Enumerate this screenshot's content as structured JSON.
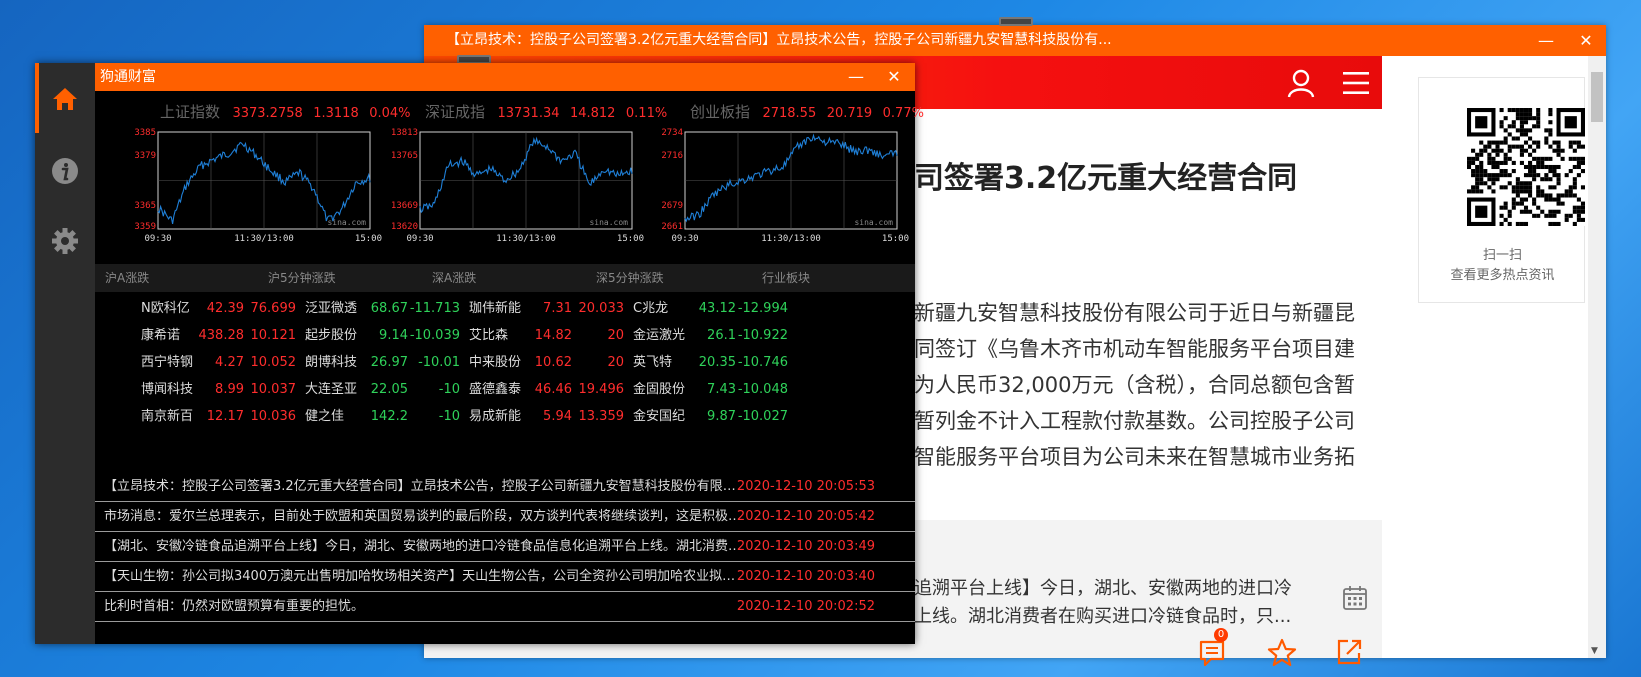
{
  "news_window": {
    "title": "【立昂技术：控股子公司签署3.2亿元重大经营合同】立昂技术公告，控股子公司新疆九安智慧科技股份有...",
    "minimize": "—",
    "close": "✕",
    "article_title": "司签署3.2亿元重大经营合同",
    "article_lines": [
      "新疆九安智慧科技股份有限公司于近日与新疆昆",
      "同签订《乌鲁木齐市机动车智能服务平台项目建",
      "为人民币32,000万元（含税），合同总额包含暂",
      "暂列金不计入工程款付款基数。公司控股子公司",
      "智能服务平台项目为公司未来在智慧城市业务拓"
    ],
    "related_lines": [
      "追溯平台上线】今日，湖北、安徽两地的进口冷",
      "上线。湖北消费者在购买进口冷链食品时，只..."
    ],
    "comment_count": "0",
    "qr_caption_line1": "扫一扫",
    "qr_caption_line2": "查看更多热点资讯",
    "scroll_down": "▼"
  },
  "stock_window": {
    "title": "狗通财富",
    "minimize": "—",
    "close": "✕",
    "sidebar": [
      {
        "name": "home",
        "icon": "home-icon",
        "active": true
      },
      {
        "name": "info",
        "icon": "info-icon",
        "active": false
      },
      {
        "name": "settings",
        "icon": "gear-icon",
        "active": false
      }
    ],
    "indices": [
      {
        "name": "上证指数",
        "value": "3373.2758",
        "change": "1.3118",
        "pct": "0.04%"
      },
      {
        "name": "深证成指",
        "value": "13731.34",
        "change": "14.812",
        "pct": "0.11%"
      },
      {
        "name": "创业板指",
        "value": "2718.55",
        "change": "20.719",
        "pct": "0.77%"
      }
    ],
    "charts": [
      {
        "y_labels": [
          "3385",
          "3379",
          "3365",
          "3359"
        ],
        "x_labels": [
          "09:30",
          "11:30/13:00",
          "15:00"
        ],
        "watermark": "sina.com"
      },
      {
        "y_labels": [
          "13813",
          "13765",
          "13669",
          "13620"
        ],
        "x_labels": [
          "09:30",
          "11:30/13:00",
          "15:00"
        ],
        "watermark": "sina.com"
      },
      {
        "y_labels": [
          "2734",
          "2716",
          "2679",
          "2661"
        ],
        "x_labels": [
          "09:30",
          "11:30/13:00",
          "15:00"
        ],
        "watermark": "sina.com"
      }
    ],
    "sections": [
      "沪A涨跌",
      "沪5分钟涨跌",
      "深A涨跌",
      "深5分钟涨跌",
      "行业板块"
    ],
    "columns": [
      {
        "direction": "up",
        "rows": [
          {
            "name": "N欧科亿",
            "price": "42.39",
            "change": "76.699"
          },
          {
            "name": "康希诺",
            "price": "438.28",
            "change": "10.121"
          },
          {
            "name": "西宁特钢",
            "price": "4.27",
            "change": "10.052"
          },
          {
            "name": "博闻科技",
            "price": "8.99",
            "change": "10.037"
          },
          {
            "name": "南京新百",
            "price": "12.17",
            "change": "10.036"
          }
        ]
      },
      {
        "direction": "down",
        "rows": [
          {
            "name": "泛亚微透",
            "price": "68.67",
            "change": "-11.713"
          },
          {
            "name": "起步股份",
            "price": "9.14",
            "change": "-10.039"
          },
          {
            "name": "朗博科技",
            "price": "26.97",
            "change": "-10.01"
          },
          {
            "name": "大连圣亚",
            "price": "22.05",
            "change": "-10"
          },
          {
            "name": "健之佳",
            "price": "142.2",
            "change": "-10"
          }
        ]
      },
      {
        "direction": "up",
        "rows": [
          {
            "name": "珈伟新能",
            "price": "7.31",
            "change": "20.033"
          },
          {
            "name": "艾比森",
            "price": "14.82",
            "change": "20"
          },
          {
            "name": "中来股份",
            "price": "10.62",
            "change": "20"
          },
          {
            "name": "盛德鑫泰",
            "price": "46.46",
            "change": "19.496"
          },
          {
            "name": "易成新能",
            "price": "5.94",
            "change": "13.359"
          }
        ]
      },
      {
        "direction": "down",
        "rows": [
          {
            "name": "C兆龙",
            "price": "43.12",
            "change": "-12.994"
          },
          {
            "name": "金运激光",
            "price": "26.1",
            "change": "-10.922"
          },
          {
            "name": "英飞特",
            "price": "20.35",
            "change": "-10.746"
          },
          {
            "name": "金固股份",
            "price": "7.43",
            "change": "-10.048"
          },
          {
            "name": "金安国纪",
            "price": "9.87",
            "change": "-10.027"
          }
        ]
      }
    ],
    "news": [
      {
        "text": "【立昂技术：控股子公司签署3.2亿元重大经营合同】立昂技术公告，控股子公司新疆九安智慧科技股份有限公...",
        "time": "2020-12-10 20:05:53"
      },
      {
        "text": "市场消息：爱尔兰总理表示，目前处于欧盟和英国贸易谈判的最后阶段，双方谈判代表将继续谈判，这是积极的。...",
        "time": "2020-12-10 20:05:42"
      },
      {
        "text": "【湖北、安徽冷链食品追溯平台上线】今日，湖北、安徽两地的进口冷链食品信息化追溯平台上线。湖北消费者在...",
        "time": "2020-12-10 20:03:49"
      },
      {
        "text": "【天山生物：孙公司拟3400万澳元出售明加哈牧场相关资产】天山生物公告，公司全资孙公司明加哈农业拟向...",
        "time": "2020-12-10 20:03:40"
      },
      {
        "text": " 比利时首相：仍然对欧盟预算有重要的担忧。",
        "time": "2020-12-10 20:02:52"
      }
    ]
  },
  "colors": {
    "accent": "#ff6000",
    "up": "#ff2d2d",
    "down": "#2fd25a",
    "chart_line": "#1f7fd6"
  }
}
